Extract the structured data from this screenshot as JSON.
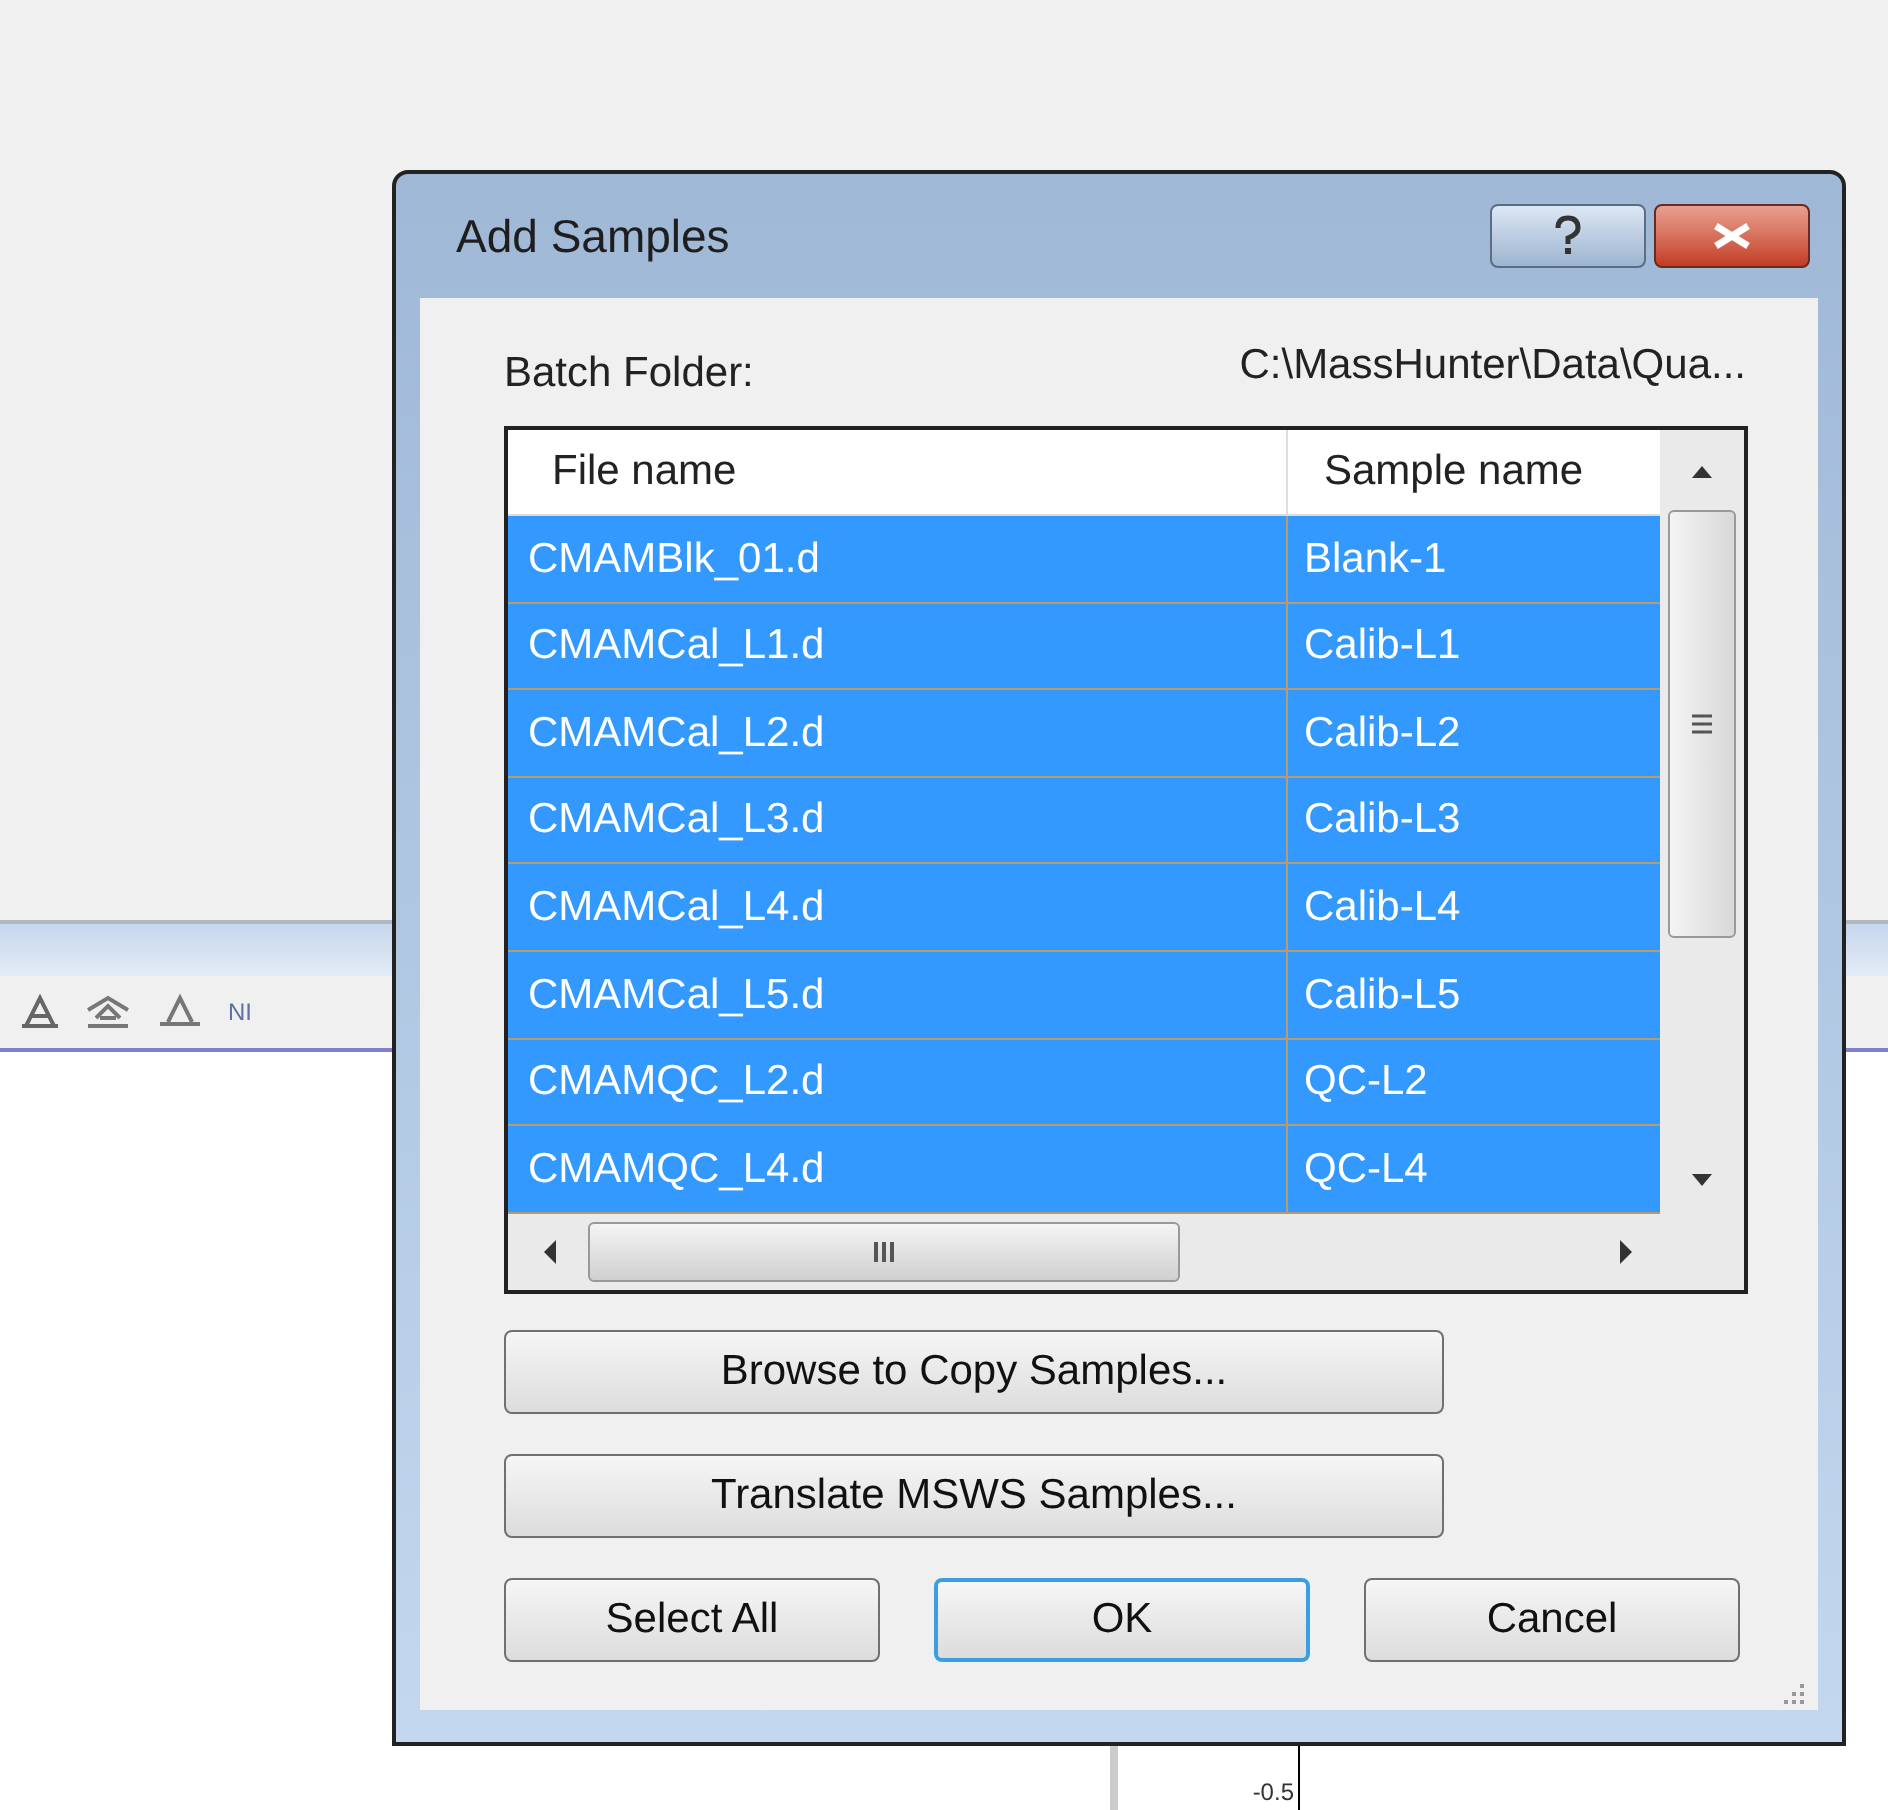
{
  "background": {
    "toolbar_label": "NI",
    "axis_label": "-0.5"
  },
  "dialog": {
    "title": "Add Samples",
    "batch_folder_label": "Batch Folder:",
    "batch_folder_value": "C:\\MassHunter\\Data\\Qua...",
    "table": {
      "columns": [
        "File name",
        "Sample name"
      ],
      "rows": [
        {
          "file": "CMAMBlk_01.d",
          "sample": "Blank-1",
          "selected": true
        },
        {
          "file": "CMAMCal_L1.d",
          "sample": "Calib-L1",
          "selected": true
        },
        {
          "file": "CMAMCal_L2.d",
          "sample": "Calib-L2",
          "selected": true
        },
        {
          "file": "CMAMCal_L3.d",
          "sample": "Calib-L3",
          "selected": true
        },
        {
          "file": "CMAMCal_L4.d",
          "sample": "Calib-L4",
          "selected": true
        },
        {
          "file": "CMAMCal_L5.d",
          "sample": "Calib-L5",
          "selected": true
        },
        {
          "file": "CMAMQC_L2.d",
          "sample": "QC-L2",
          "selected": true
        },
        {
          "file": "CMAMQC_L4.d",
          "sample": "QC-L4",
          "selected": true
        }
      ]
    },
    "buttons": [
      {
        "label": "Browse to Copy Samples...",
        "kind": "wide",
        "focused": false
      },
      {
        "label": "Translate MSWS Samples...",
        "kind": "wide",
        "focused": false
      },
      {
        "label": "Select All",
        "kind": "bottom",
        "focused": false
      },
      {
        "label": "OK",
        "kind": "bottom",
        "focused": true
      },
      {
        "label": "Cancel",
        "kind": "bottom",
        "focused": false
      }
    ]
  }
}
